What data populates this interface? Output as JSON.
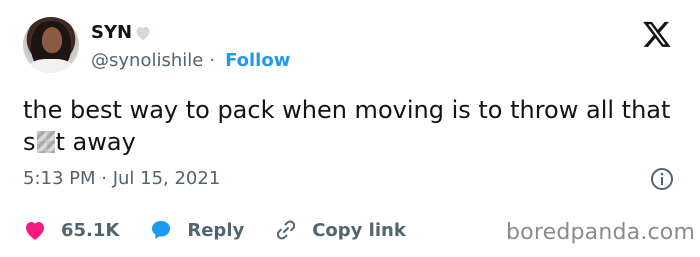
{
  "user": {
    "display_name": "SYN",
    "handle": "@synolishile",
    "separator": "·",
    "follow_label": "Follow"
  },
  "tweet": {
    "text_before": "the best way to pack when moving is to throw all that s",
    "text_after": "t away",
    "timestamp": "5:13 PM · Jul 15, 2021"
  },
  "actions": {
    "like_count": "65.1K",
    "reply_label": "Reply",
    "copy_link_label": "Copy link"
  },
  "watermark": "boredpanda.com",
  "colors": {
    "accent": "#1d9bf0",
    "like": "#f91880",
    "text": "#0f1419",
    "muted": "#536471",
    "heart_badge": "#cfd9de"
  },
  "icons": [
    "avatar",
    "heart-badge-icon",
    "x-logo-icon",
    "info-icon",
    "heart-icon",
    "reply-bubble-icon",
    "link-icon"
  ]
}
